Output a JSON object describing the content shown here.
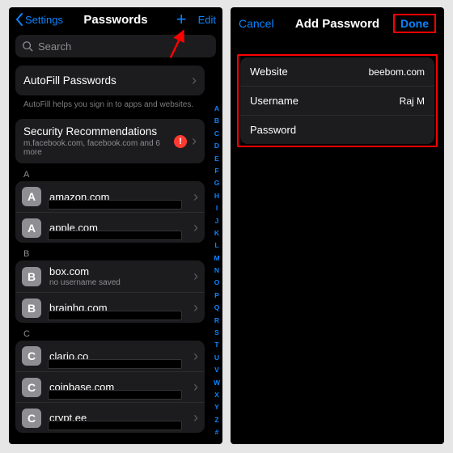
{
  "left": {
    "nav": {
      "back": "Settings",
      "title": "Passwords",
      "edit": "Edit"
    },
    "search": {
      "placeholder": "Search"
    },
    "autofill": {
      "title": "AutoFill Passwords",
      "hint": "AutoFill helps you sign in to apps and websites."
    },
    "security": {
      "title": "Security Recommendations",
      "subtitle": "m.facebook.com, facebook.com and 6 more",
      "badge": "!"
    },
    "sections": [
      {
        "letter": "A",
        "items": [
          {
            "avatar": "A",
            "primary": "amazon.com",
            "secondary": "",
            "smudge": true
          },
          {
            "avatar": "A",
            "primary": "apple.com",
            "secondary": "",
            "smudge": true
          }
        ]
      },
      {
        "letter": "B",
        "items": [
          {
            "avatar": "B",
            "primary": "box.com",
            "secondary": "no username saved",
            "smudge": false
          },
          {
            "avatar": "B",
            "primary": "brainhq.com",
            "secondary": "",
            "smudge": true
          }
        ]
      },
      {
        "letter": "C",
        "items": [
          {
            "avatar": "C",
            "primary": "clario.co",
            "secondary": "",
            "smudge": true
          },
          {
            "avatar": "C",
            "primary": "coinbase.com",
            "secondary": "",
            "smudge": true
          },
          {
            "avatar": "C",
            "primary": "crypt.ee",
            "secondary": "",
            "smudge": true
          }
        ]
      }
    ],
    "index": [
      "A",
      "B",
      "C",
      "D",
      "E",
      "F",
      "G",
      "H",
      "I",
      "J",
      "K",
      "L",
      "M",
      "N",
      "O",
      "P",
      "Q",
      "R",
      "S",
      "T",
      "U",
      "V",
      "W",
      "X",
      "Y",
      "Z",
      "#"
    ]
  },
  "right": {
    "nav": {
      "cancel": "Cancel",
      "title": "Add Password",
      "done": "Done"
    },
    "form": {
      "website": {
        "label": "Website",
        "value": "beebom.com"
      },
      "username": {
        "label": "Username",
        "value": "Raj M"
      },
      "password": {
        "label": "Password",
        "value": ""
      }
    }
  }
}
